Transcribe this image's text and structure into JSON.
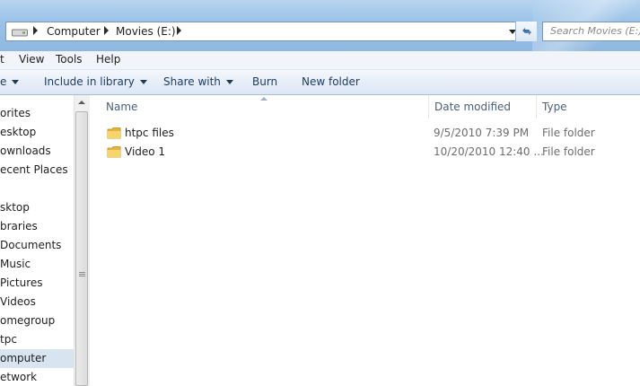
{
  "address": {
    "crumbs": [
      "Computer",
      "Movies (E:)"
    ],
    "drive_icon": "drive-icon",
    "refresh_icon": "refresh-icon"
  },
  "search": {
    "placeholder": "Search Movies (E:)"
  },
  "menu": {
    "items": [
      "t",
      "View",
      "Tools",
      "Help"
    ]
  },
  "toolbar": {
    "items": [
      {
        "label": "e",
        "has_dropdown": true
      },
      {
        "label": "Include in library",
        "has_dropdown": true
      },
      {
        "label": "Share with",
        "has_dropdown": true
      },
      {
        "label": "Burn",
        "has_dropdown": false
      },
      {
        "label": "New folder",
        "has_dropdown": false
      }
    ]
  },
  "nav": {
    "items": [
      {
        "label": "orites"
      },
      {
        "label": "esktop"
      },
      {
        "label": "ownloads"
      },
      {
        "label": "ecent Places"
      },
      {
        "label": ""
      },
      {
        "label": "sktop"
      },
      {
        "label": "braries"
      },
      {
        "label": "Documents"
      },
      {
        "label": "Music"
      },
      {
        "label": "Pictures"
      },
      {
        "label": "Videos"
      },
      {
        "label": "omegroup"
      },
      {
        "label": "tpc"
      },
      {
        "label": "omputer",
        "selected": true
      },
      {
        "label": "etwork"
      }
    ]
  },
  "columns": {
    "name": "Name",
    "date": "Date modified",
    "type": "Type"
  },
  "files": [
    {
      "name": "htpc files",
      "date": "9/5/2010 7:39 PM",
      "type": "File folder",
      "icon": "folder-icon"
    },
    {
      "name": "Video 1",
      "date": "10/20/2010 12:40 ...",
      "type": "File folder",
      "icon": "folder-icon"
    }
  ],
  "colors": {
    "titlebar": "#9cc3e8",
    "selection": "#d9e4f1",
    "command_text": "#1e3a5f",
    "folder_yellow": "#f2c94c"
  }
}
